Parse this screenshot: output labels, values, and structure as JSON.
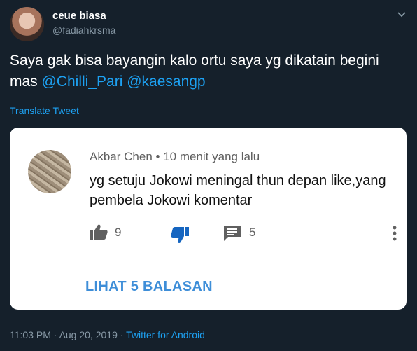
{
  "tweet": {
    "display_name": "ceue biasa",
    "handle": "@fadiahkrsma",
    "text_prefix": "Saya gak bisa bayangin kalo ortu saya yg dikatain begini mas ",
    "mention_1": "@Chilli_Pari",
    "mention_2": "@kaesangp",
    "translate_label": "Translate Tweet",
    "time": "11:03 PM",
    "separator_1": " · ",
    "date": "Aug 20, 2019",
    "separator_2": " · ",
    "source": "Twitter for Android"
  },
  "embedded_comment": {
    "author": "Akbar Chen",
    "bullet": " • ",
    "time_ago": "10 menit yang lalu",
    "text": "yg setuju Jokowi meningal thun depan like,yang pembela Jokowi komentar",
    "like_count": "9",
    "reply_count": "5",
    "view_replies_label": "LIHAT 5 BALASAN"
  },
  "colors": {
    "background": "#15202b",
    "accent": "#1da1f2",
    "muted": "#8899a6",
    "card_link": "#3e8ed8"
  },
  "icons": {
    "caret": "chevron-down-icon",
    "like": "thumbs-up-icon",
    "dislike": "thumbs-down-icon",
    "reply": "comment-icon",
    "more": "more-vertical-icon"
  }
}
